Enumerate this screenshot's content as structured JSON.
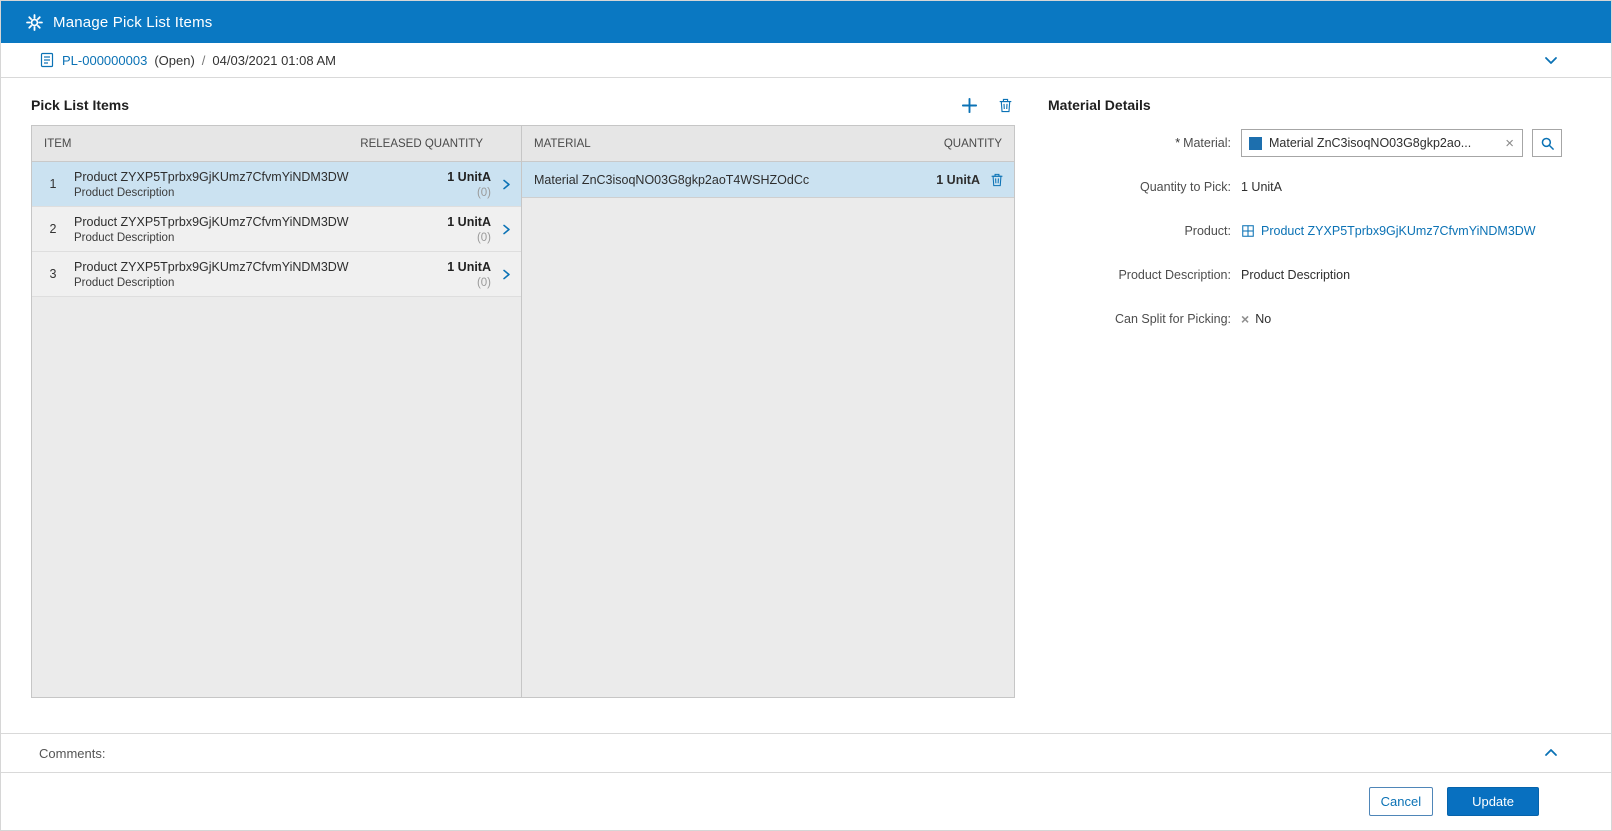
{
  "colors": {
    "header_bg": "#0a78c2",
    "link_blue": "#0b72b5",
    "primary_button_bg": "#0870c0",
    "selected_row_bg": "#cbe2f1"
  },
  "header": {
    "title": "Manage Pick List Items"
  },
  "subheader": {
    "pick_list_number": "PL-000000003",
    "status": "(Open)",
    "separator": "/",
    "timestamp": "04/03/2021 01:08 AM"
  },
  "pick_list": {
    "title": "Pick List Items",
    "columns": {
      "item": "ITEM",
      "released_quantity": "RELEASED QUANTITY",
      "material": "MATERIAL",
      "quantity": "QUANTITY"
    },
    "item_rows": [
      {
        "num": "1",
        "product": "Product ZYXP5Tprbx9GjKUmz7CfvmYiNDM3DW",
        "description": "Product Description",
        "released_qty": "1 UnitA",
        "released_sub": "(0)"
      },
      {
        "num": "2",
        "product": "Product ZYXP5Tprbx9GjKUmz7CfvmYiNDM3DW",
        "description": "Product Description",
        "released_qty": "1 UnitA",
        "released_sub": "(0)"
      },
      {
        "num": "3",
        "product": "Product ZYXP5Tprbx9GjKUmz7CfvmYiNDM3DW",
        "description": "Product Description",
        "released_qty": "1 UnitA",
        "released_sub": "(0)"
      }
    ],
    "material_rows": [
      {
        "material": "Material ZnC3isoqNO03G8gkp2aoT4WSHZOdCc",
        "quantity": "1 UnitA"
      }
    ]
  },
  "material_details": {
    "title": "Material Details",
    "required_marker": "*",
    "material_label": "Material:",
    "material_value": "Material ZnC3isoqNO03G8gkp2ao...",
    "clear_icon": "×",
    "quantity_label": "Quantity to Pick:",
    "quantity_value": "1 UnitA",
    "product_label": "Product:",
    "product_value": "Product ZYXP5Tprbx9GjKUmz7CfvmYiNDM3DW",
    "description_label": "Product Description:",
    "description_value": "Product Description",
    "split_label": "Can Split for Picking:",
    "split_icon": "×",
    "split_value": "No"
  },
  "comments": {
    "label": "Comments:"
  },
  "footer": {
    "cancel_label": "Cancel",
    "update_label": "Update"
  }
}
